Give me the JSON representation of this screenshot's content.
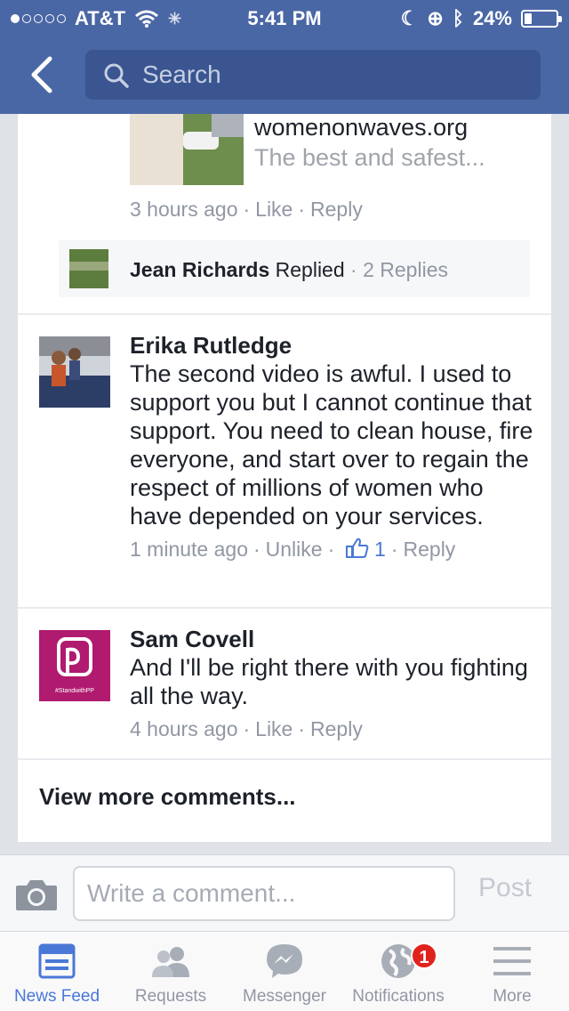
{
  "status_bar": {
    "carrier": "AT&T",
    "time": "5:41 PM",
    "battery": "24%",
    "battery_level": 0.24,
    "signal_bars": 1
  },
  "nav": {
    "search_placeholder": "Search"
  },
  "link_preview": {
    "site": "womenonwaves.org",
    "description": "The best and safest..."
  },
  "top_comment_meta": {
    "time": "3 hours ago",
    "like": "Like",
    "reply": "Reply"
  },
  "reply_summary": {
    "name": "Jean Richards",
    "action": "Replied",
    "count": "2 Replies"
  },
  "comments": [
    {
      "name": "Erika Rutledge",
      "text": "The second video is awful. I used to support you but I cannot continue that support. You need to clean house, fire everyone, and start over to regain the respect of millions of women who have depended on your services.",
      "time": "1 minute ago",
      "like": "Unlike",
      "likes": "1",
      "reply": "Reply"
    },
    {
      "name": "Sam Covell",
      "text": "And I'll be right there with you fighting all the way.",
      "time": "4 hours ago",
      "like": "Like",
      "reply": "Reply",
      "avatar_caption": "#StandwithPP"
    }
  ],
  "view_more": "View more comments...",
  "composer": {
    "placeholder": "Write a comment...",
    "post": "Post"
  },
  "tabs": [
    {
      "label": "News Feed",
      "icon": "news-feed-icon",
      "active": true
    },
    {
      "label": "Requests",
      "icon": "requests-icon"
    },
    {
      "label": "Messenger",
      "icon": "messenger-icon"
    },
    {
      "label": "Notifications",
      "icon": "globe-icon",
      "badge": "1"
    },
    {
      "label": "More",
      "icon": "menu-icon"
    }
  ],
  "colors": {
    "nav_bar": "#4a67a5",
    "active_tab": "#4a78d6",
    "badge": "#e0221d",
    "pp_avatar": "#b01a6f"
  }
}
